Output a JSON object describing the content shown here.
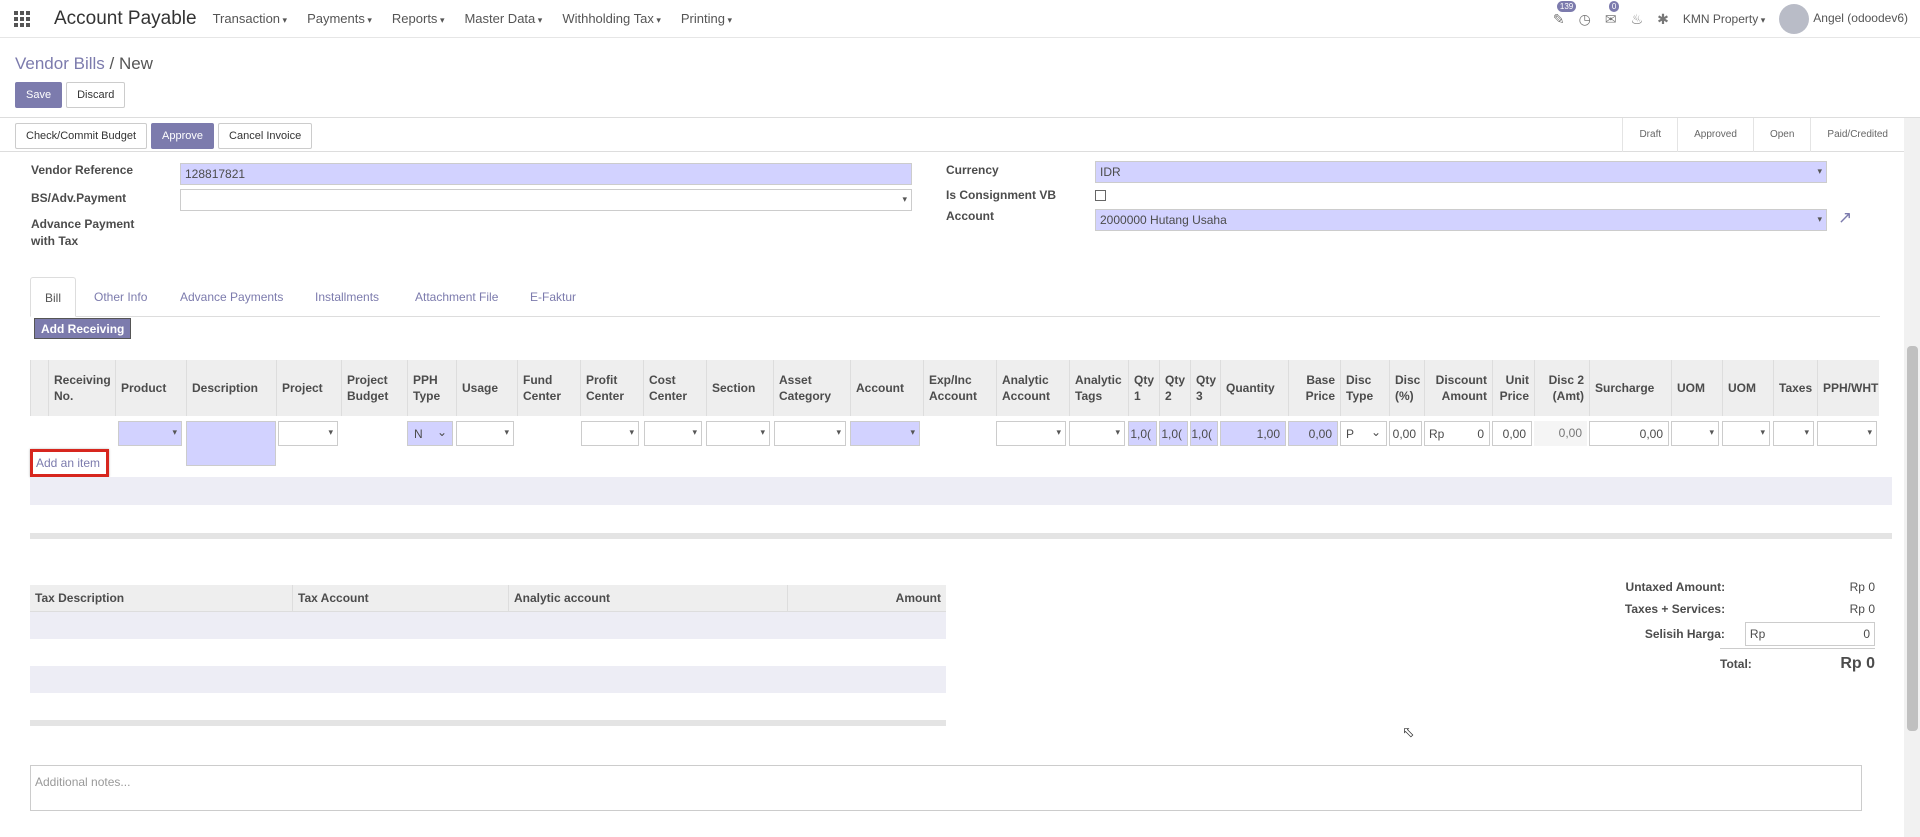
{
  "topbar": {
    "app_title": "Account Payable",
    "menus": [
      "Transaction",
      "Payments",
      "Reports",
      "Master Data",
      "Withholding Tax",
      "Printing"
    ],
    "activity_badge": "139",
    "messages_badge": "0",
    "company": "KMN Property",
    "user": "Angel (odoodev6)"
  },
  "breadcrumb": {
    "parent": "Vendor Bills",
    "current": "New"
  },
  "actions": {
    "save": "Save",
    "discard": "Discard"
  },
  "header": {
    "buttons": [
      "Check/Commit Budget",
      "Approve",
      "Cancel Invoice"
    ],
    "stages": [
      "Draft",
      "Approved",
      "Open",
      "Paid/Credited"
    ]
  },
  "form": {
    "vendor_reference_label": "Vendor Reference",
    "vendor_reference_value": "128817821",
    "bs_adv_label": "BS/Adv.Payment",
    "adv_tax_label": "Advance Payment with Tax",
    "currency_label": "Currency",
    "currency_value": "IDR",
    "consignment_label": "Is Consignment VB",
    "account_label": "Account",
    "account_value": "2000000 Hutang Usaha"
  },
  "tabs": [
    "Bill",
    "Other Info",
    "Advance Payments",
    "Installments",
    "Attachment File",
    "E-Faktur"
  ],
  "add_receiving": "Add Receiving",
  "line_columns": [
    "Receiving No.",
    "Product",
    "Description",
    "Project",
    "Project Budget",
    "PPH Type",
    "Usage",
    "Fund Center",
    "Profit Center",
    "Cost Center",
    "Section",
    "Asset Category",
    "Account",
    "Exp/Inc Account",
    "Analytic Account",
    "Analytic Tags",
    "Qty 1",
    "Qty 2",
    "Qty 3",
    "Quantity",
    "Base Price",
    "Disc Type",
    "Disc (%)",
    "Discount Amount",
    "Unit Price",
    "Disc 2 (Amt)",
    "Surcharge",
    "UOM",
    "UOM",
    "Taxes",
    "PPH/WHT"
  ],
  "line_values": {
    "pph": "N",
    "qty1": "1,0(",
    "qty2": "1,0(",
    "qty3": "1,0(",
    "quantity": "1,00",
    "base_price": "0,00",
    "disc_type": "P",
    "disc_pct": "0,00",
    "discount_currency": "Rp",
    "discount_amount": "0",
    "unit_price": "0,00",
    "disc2": "0,00",
    "surcharge": "0,00"
  },
  "add_item": "Add an item",
  "tax_columns": [
    "Tax Description",
    "Tax Account",
    "Analytic account",
    "Amount"
  ],
  "totals": {
    "untaxed_label": "Untaxed Amount:",
    "untaxed_value": "Rp 0",
    "taxes_label": "Taxes + Services:",
    "taxes_value": "Rp 0",
    "selisih_label": "Selisih Harga:",
    "selisih_currency": "Rp",
    "selisih_value": "0",
    "total_label": "Total:",
    "total_value": "Rp 0"
  },
  "notes_placeholder": "Additional notes..."
}
